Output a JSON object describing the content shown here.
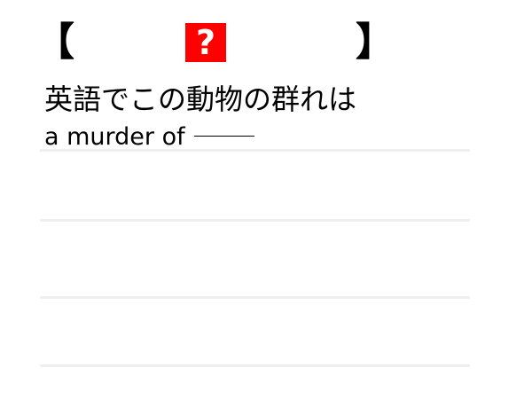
{
  "header": {
    "bracket_left": "【",
    "question_mark": "?",
    "bracket_right": "】",
    "badge_color": "#ff0000"
  },
  "question": {
    "title": "英語でこの動物の群れは",
    "phrase": "a murder of"
  },
  "answer_lines": {
    "count": 4,
    "line_color": "#efefef"
  }
}
